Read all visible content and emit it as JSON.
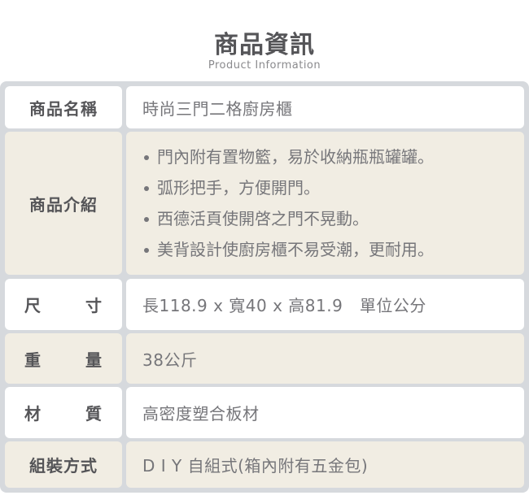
{
  "header": {
    "title": "商品資訊",
    "subtitle": "Product Information"
  },
  "rows": [
    {
      "label": "商品名稱",
      "value": "時尚三門二格廚房櫃"
    },
    {
      "label": "商品介紹",
      "features": [
        "門內附有置物籃，易於收納瓶瓶罐罐。",
        "弧形把手，方便開門。",
        "西德活頁使開啓之門不晃動。",
        "美背設計使廚房櫃不易受潮，更耐用。"
      ]
    },
    {
      "label_chars": [
        "尺",
        "寸"
      ],
      "value": "長118.9 x 寬40 x 高81.9　單位公分"
    },
    {
      "label_chars": [
        "重",
        "量"
      ],
      "value": "38公斤"
    },
    {
      "label_chars": [
        "材",
        "質"
      ],
      "value": "高密度塑合板材"
    },
    {
      "label": "組裝方式",
      "value": "D I Y 自組式(箱內附有五金包)"
    }
  ],
  "colors": {
    "frame": "#d6d9dd",
    "row_white": "#ffffff",
    "row_beige": "#f1ede3",
    "label_text": "#555558",
    "value_text": "#76767a"
  }
}
